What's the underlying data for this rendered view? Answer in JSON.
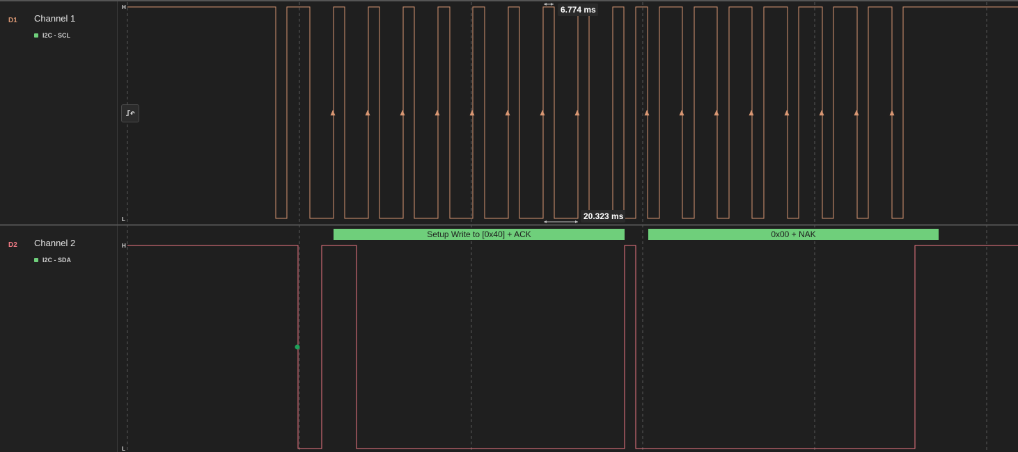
{
  "colors": {
    "background": "#1f1f1f",
    "sidebar": "#212121",
    "channel1": "#d99773",
    "channel2": "#f07a84",
    "analyzer_frame": "#6fcf7b",
    "grid": "#5a5a5a",
    "divider": "#555555"
  },
  "channels": [
    {
      "id_label": "D1",
      "name": "Channel 1",
      "analyzer_label": "I2C - SCL",
      "high_label": "H",
      "low_label": "L"
    },
    {
      "id_label": "D2",
      "name": "Channel 2",
      "analyzer_label": "I2C - SDA",
      "high_label": "H",
      "low_label": "L"
    }
  ],
  "measurements": {
    "width": "6.774 ms",
    "period": "20.323 ms"
  },
  "frames": [
    {
      "label": "Setup Write to [0x40] + ACK"
    },
    {
      "label": "0x00 + NAK"
    }
  ],
  "icons": {
    "trigger_button": "trigger-edge-icon",
    "edge_marker": "rising-edge-arrow-icon",
    "start_marker": "start-condition-dot-icon"
  }
}
